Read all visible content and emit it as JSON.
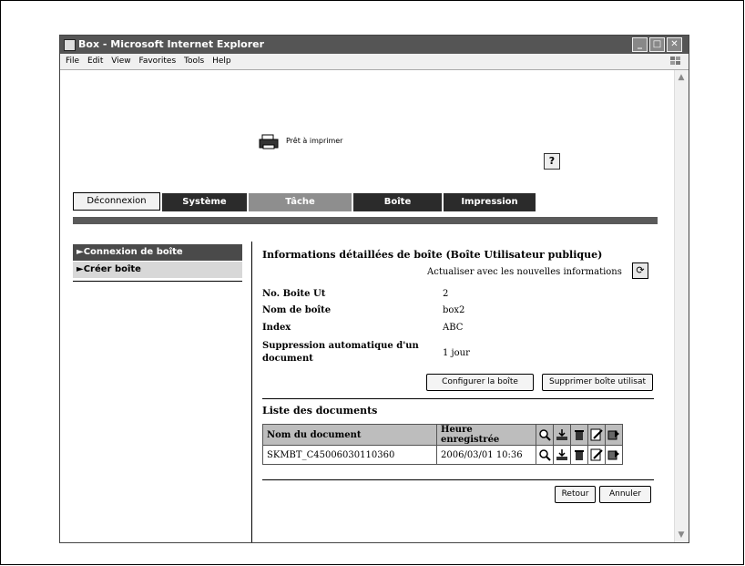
{
  "window": {
    "title": "Box - Microsoft Internet Explorer",
    "menu": [
      "File",
      "Edit",
      "View",
      "Favorites",
      "Tools",
      "Help"
    ]
  },
  "header": {
    "status": "Prêt à imprimer",
    "help_label": "?"
  },
  "nav": {
    "logout": "Déconnexion",
    "tabs": [
      {
        "label": "Système",
        "active": false
      },
      {
        "label": "Tâche",
        "active": true
      },
      {
        "label": "Boîte",
        "active": false
      },
      {
        "label": "Impression",
        "active": false
      }
    ]
  },
  "sidebar": {
    "items": [
      {
        "label": "►Connexion de boîte",
        "active": true
      },
      {
        "label": "►Créer boîte",
        "active": false
      }
    ]
  },
  "details": {
    "title": "Informations détaillées de boîte (Boîte Utilisateur publique)",
    "refresh_text": "Actualiser avec les nouvelles informations",
    "fields": [
      {
        "label": "No. Boite Ut",
        "value": "2"
      },
      {
        "label": "Nom de boîte",
        "value": "box2"
      },
      {
        "label": "Index",
        "value": "ABC"
      },
      {
        "label": "Suppression automatique d'un document",
        "value": "1 jour"
      }
    ],
    "configure_button": "Configurer la boîte",
    "delete_button": "Supprimer boîte utilisat"
  },
  "documents": {
    "title": "Liste des documents",
    "columns": [
      "Nom du document",
      "Heure enregistrée"
    ],
    "rows": [
      {
        "name": "SKMBT_C45006030110360",
        "time": "2006/03/01  10:36"
      }
    ]
  },
  "footer": {
    "back_button": "Retour",
    "cancel_button": "Annuler"
  },
  "colors": {
    "tab_dark": "#2b2b2b",
    "tab_active": "#8e8e8e",
    "divider_bar": "#5a5a5a"
  }
}
